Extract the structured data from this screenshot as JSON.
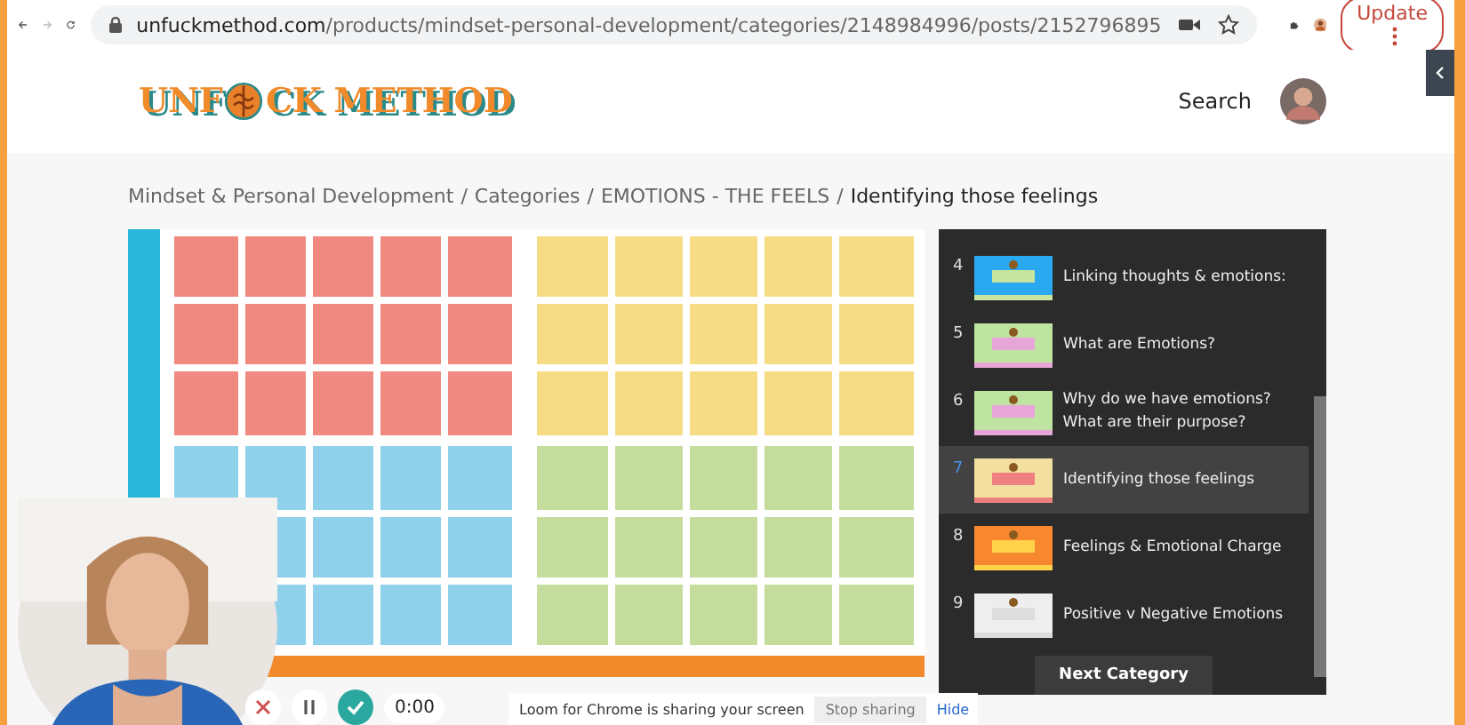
{
  "browser": {
    "url_host": "unfuckmethod.com",
    "url_path": "/products/mindset-personal-development/categories/2148984996/posts/2152796895",
    "update_label": "Update"
  },
  "header": {
    "logo_left": "UNF",
    "logo_right": "CK METHOD",
    "search": "Search"
  },
  "breadcrumb_separator": "/",
  "breadcrumb": [
    "Mindset & Personal Development",
    "Categories",
    "EMOTIONS - THE FEELS",
    "Identifying those feelings"
  ],
  "lessons": [
    {
      "number": "4",
      "title": "Linking thoughts & emotions:",
      "selected": false
    },
    {
      "number": "5",
      "title": "What are Emotions?",
      "selected": false
    },
    {
      "number": "6",
      "title": "Why do we have emotions? What are their purpose?",
      "selected": false
    },
    {
      "number": "7",
      "title": "Identifying those feelings",
      "selected": true
    },
    {
      "number": "8",
      "title": "Feelings & Emotional Charge",
      "selected": false
    },
    {
      "number": "9",
      "title": "Positive v Negative Emotions",
      "selected": false
    }
  ],
  "next_button": "Next Category",
  "recorder": {
    "timer": "0:00",
    "notice": "Loom for Chrome is sharing your screen",
    "stop": "Stop sharing",
    "hide": "Hide"
  }
}
